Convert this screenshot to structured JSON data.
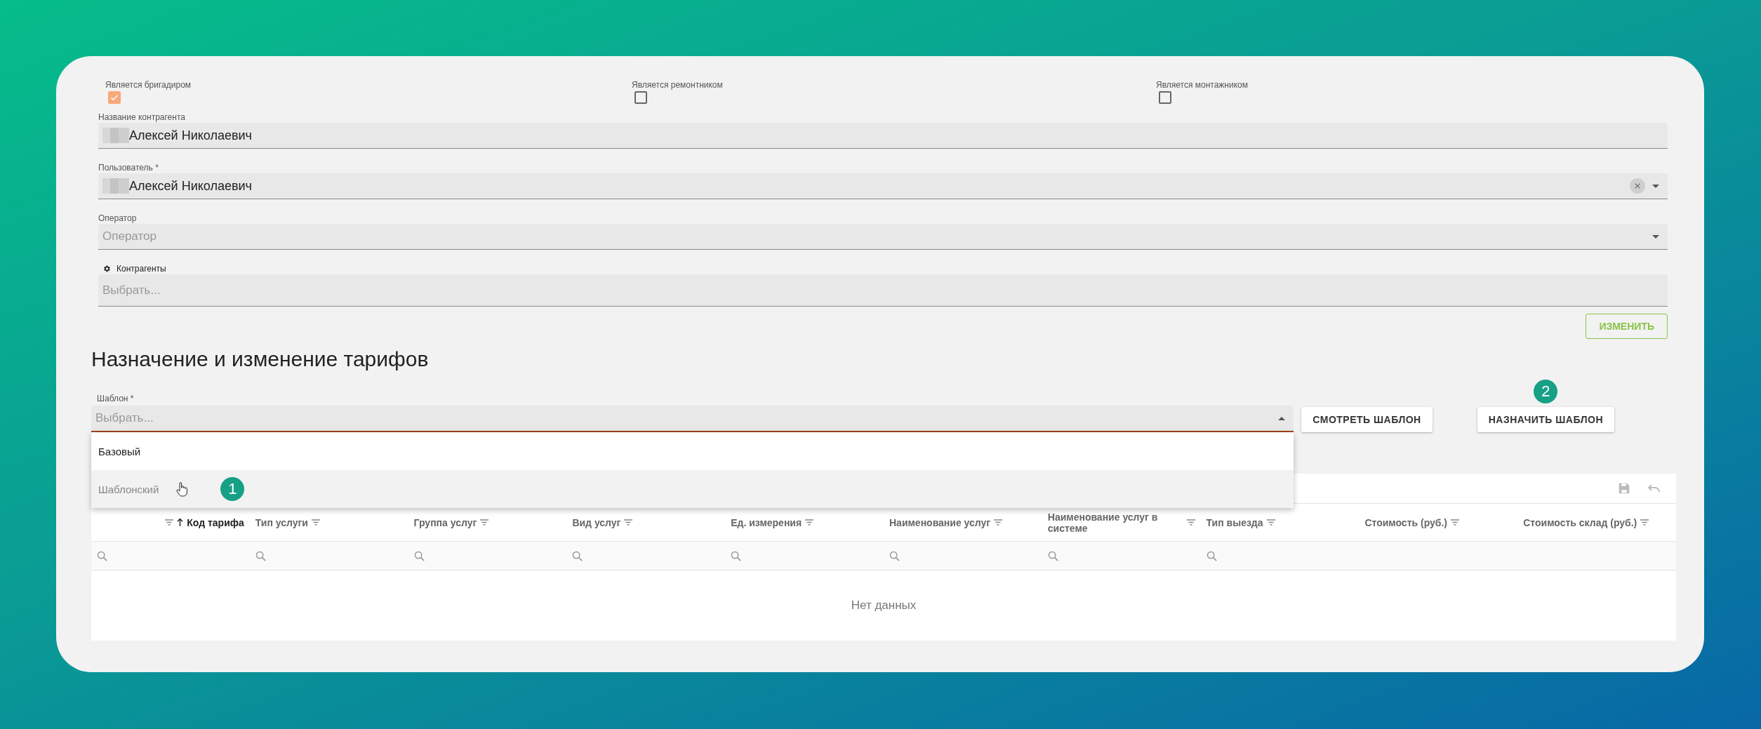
{
  "checkboxes": [
    {
      "label": "Является бригадиром",
      "checked": true
    },
    {
      "label": "Является ремонтником",
      "checked": false
    },
    {
      "label": "Является монтажником",
      "checked": false
    }
  ],
  "fields": [
    {
      "kind": "text",
      "label": "Название контрагента",
      "value": "Алексей Николаевич",
      "redacted": true
    },
    {
      "kind": "select",
      "label": "Пользователь *",
      "value": "Алексей Николаевич",
      "redacted": true,
      "clearable": true
    },
    {
      "kind": "select",
      "label": "Оператор",
      "placeholder": "Оператор",
      "redacted": false,
      "clearable": false
    },
    {
      "kind": "tags",
      "label": "Контрагенты",
      "placeholder": "Выбрать...",
      "redacted": false
    }
  ],
  "save_button": "ИЗМЕНИТЬ",
  "section_title": "Назначение и изменение тарифов",
  "template": {
    "label": "Шаблон *",
    "placeholder": "Выбрать...",
    "expanded": true,
    "options": [
      {
        "label": "Базовый",
        "selected": false,
        "hovered": false
      },
      {
        "label": "Шаблонский",
        "selected": false,
        "hovered": true,
        "marker": "1"
      }
    ]
  },
  "buttons": [
    {
      "label": "СМОТРЕТЬ ШАБЛОН"
    },
    {
      "label": "НАЗНАЧИТЬ ШАБЛОН",
      "marker": "2"
    }
  ],
  "table": {
    "columns": [
      {
        "label": "Код тарифа",
        "sorted": true,
        "searchable": true
      },
      {
        "label": "Тип услуги",
        "sorted": false,
        "searchable": true
      },
      {
        "label": "Группа услуг",
        "sorted": false,
        "searchable": true
      },
      {
        "label": "Вид услуг",
        "sorted": false,
        "searchable": true
      },
      {
        "label": "Ед. измерения",
        "sorted": false,
        "searchable": true
      },
      {
        "label": "Наименование услуг",
        "sorted": false,
        "searchable": true
      },
      {
        "label": "Наименование услуг в системе",
        "sorted": false,
        "searchable": true
      },
      {
        "label": "Тип выезда",
        "sorted": false,
        "searchable": true
      },
      {
        "label": "Стоимость (руб.)",
        "sorted": false,
        "searchable": false
      },
      {
        "label": "Стоимость склад (руб.)",
        "sorted": false,
        "searchable": false
      }
    ],
    "empty_text": "Нет данных"
  }
}
